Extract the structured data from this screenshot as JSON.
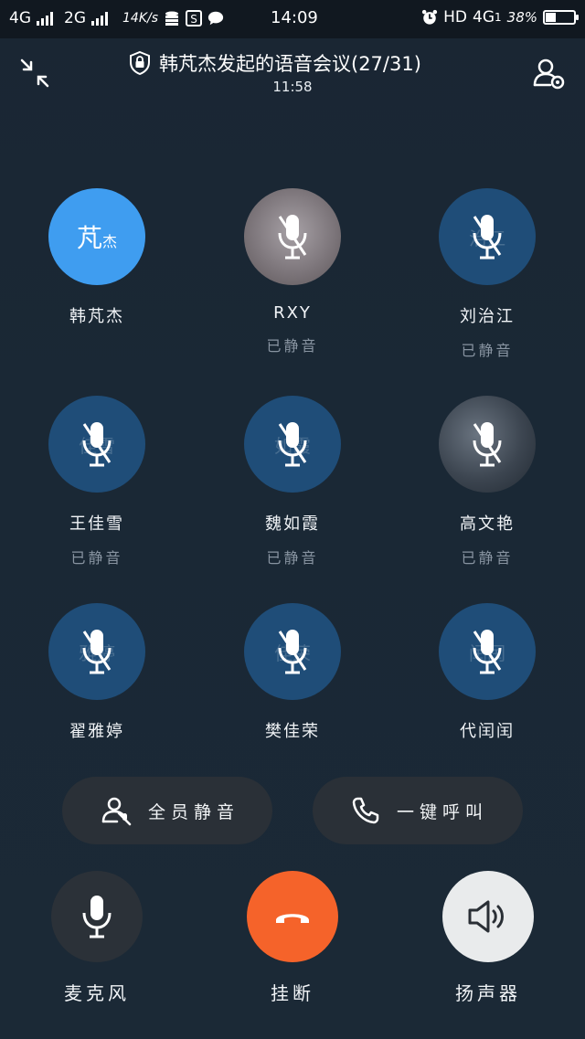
{
  "status_bar": {
    "net1": "4G",
    "net2": "2G",
    "speed": "14K/s",
    "time": "14:09",
    "hd": "HD",
    "net3": "4G",
    "net3_sub": "1",
    "battery": "38%",
    "battery_level": 0.38
  },
  "header": {
    "title": "韩芃杰发起的语音会议(27/31)",
    "duration": "11:58"
  },
  "participants": [
    {
      "name": "韩芃杰",
      "status": "",
      "initials": "芃",
      "initials_small": "杰",
      "style": "blue",
      "muted": false,
      "ghost": ""
    },
    {
      "name": "RXY",
      "status": "已静音",
      "style": "photo1",
      "muted": true,
      "ghost": ""
    },
    {
      "name": "刘治江",
      "status": "已静音",
      "style": "dark",
      "muted": true,
      "ghost": "治江"
    },
    {
      "name": "王佳雪",
      "status": "已静音",
      "style": "dark",
      "muted": true,
      "ghost": "佳雪"
    },
    {
      "name": "魏如霞",
      "status": "已静音",
      "style": "dark",
      "muted": true,
      "ghost": "如霞"
    },
    {
      "name": "高文艳",
      "status": "已静音",
      "style": "photo2",
      "muted": true,
      "ghost": ""
    },
    {
      "name": "翟雅婷",
      "status": "",
      "style": "dark",
      "muted": true,
      "ghost": "雅婷"
    },
    {
      "name": "樊佳荣",
      "status": "",
      "style": "dark",
      "muted": true,
      "ghost": "佳荣"
    },
    {
      "name": "代闰闰",
      "status": "",
      "style": "dark",
      "muted": true,
      "ghost": "闰闰"
    }
  ],
  "actions": {
    "mute_all": "全员静音",
    "call_all": "一键呼叫"
  },
  "controls": {
    "mic": "麦克风",
    "hangup": "挂断",
    "speaker": "扬声器"
  },
  "colors": {
    "hangup": "#f5632a",
    "speaker_bg": "#e9ebec",
    "mic_bg": "#2b3138",
    "avatar_blue": "#3f9df0",
    "avatar_dark": "#1f4d78"
  }
}
